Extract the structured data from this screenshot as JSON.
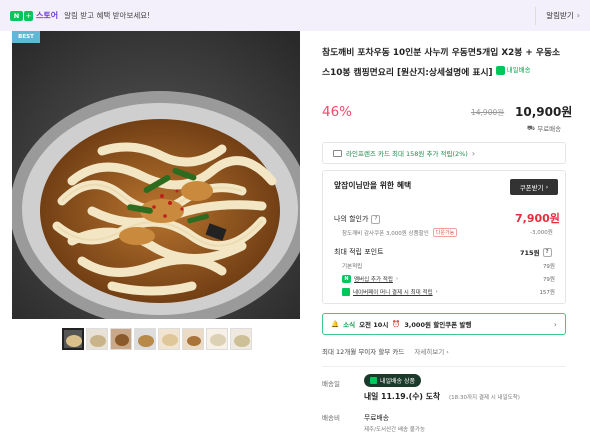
{
  "topbar": {
    "store_label": "스토어",
    "banner": "알림 받고 혜택 받아보세요!",
    "alarm_button": "알림받기"
  },
  "gallery": {
    "badge": "BEST"
  },
  "product": {
    "title": "참도깨비 포차우동 10인분 사누끼 우동면5개입 X2봉 + 우동소스10봉 캠핑면요리 [원산지:상세설명에 표시]",
    "delivery_badge": "내일배송",
    "discount_rate": "46%",
    "original_price": "14,900원",
    "sale_price": "10,900원",
    "shipping": "무료배송"
  },
  "card_promo": {
    "text": "라인프렌즈 카드 최대 158원 추가 적립(2%)"
  },
  "benefits": {
    "heading": "앞잡이님만을 위한 혜택",
    "coupon_button": "쿠폰받기",
    "my_price_label": "나의 할인가",
    "my_price": "7,900원",
    "coupon_line": "참도깨비 감사쿠폰 3,000원 상품할인",
    "coupon_tag": "다운가능",
    "coupon_amount": "-3,000원",
    "points_label": "최대 적립 포인트",
    "points_total": "715원",
    "point_rows": [
      {
        "label": "기본적립",
        "value": "79원"
      },
      {
        "label": "멤버십 추가 적립",
        "value": "79원"
      },
      {
        "label": "네이버페이 머니 결제 시 최대 적립",
        "value": "157원"
      }
    ]
  },
  "alert": {
    "prefix": "소식",
    "time": "오전 10시",
    "text": "3,000원 할인쿠폰 발행"
  },
  "installment": {
    "text": "최대 12개월 무이자 할부 카드",
    "more": "자세히보기"
  },
  "delivery": {
    "label": "배송일",
    "badge": "내일배송 상품",
    "date": "내일 11.19.(수) 도착",
    "note": "(18:30까지 결제 시 내일도착)",
    "fee_label": "배송비",
    "fee_value": "무료배송",
    "fee_note": "제주/도서산간 배송 불가능"
  }
}
